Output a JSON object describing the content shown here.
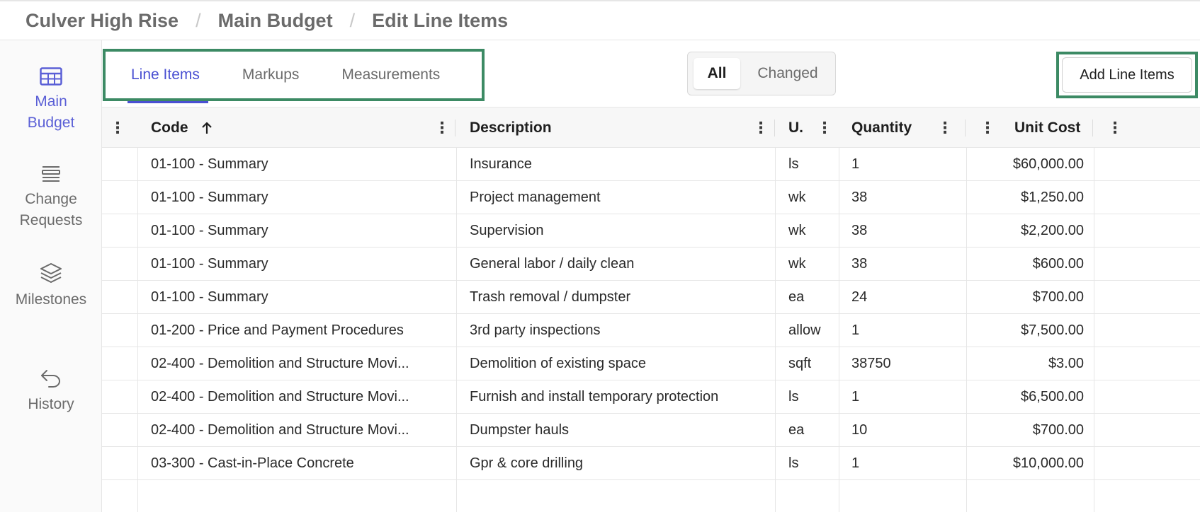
{
  "breadcrumb": [
    "Culver High Rise",
    "Main Budget",
    "Edit Line Items"
  ],
  "sidebar": {
    "items": [
      {
        "label_line1": "Main",
        "label_line2": "Budget",
        "icon": "table-icon",
        "active": true
      },
      {
        "label_line1": "Change",
        "label_line2": "Requests",
        "icon": "stack-lines-icon",
        "active": false
      },
      {
        "label_line1": "Milestones",
        "label_line2": "",
        "icon": "layers-icon",
        "active": false
      },
      {
        "label_line1": "History",
        "label_line2": "",
        "icon": "undo-arrow-icon",
        "active": false
      }
    ]
  },
  "tabs": [
    {
      "label": "Line Items",
      "active": true
    },
    {
      "label": "Markups",
      "active": false
    },
    {
      "label": "Measurements",
      "active": false
    }
  ],
  "filter": {
    "all_label": "All",
    "changed_label": "Changed",
    "selected": "All"
  },
  "actions": {
    "add_label": "Add Line Items"
  },
  "table": {
    "headers": {
      "code": "Code",
      "description": "Description",
      "unit": "U.",
      "quantity": "Quantity",
      "unit_cost": "Unit Cost"
    },
    "sort": {
      "column": "code",
      "direction": "ascending",
      "icon": "arrow-up-icon"
    },
    "rows": [
      {
        "code": "01-100 - Summary",
        "description": "Insurance",
        "unit": "ls",
        "quantity": "1",
        "unit_cost": "$60,000.00"
      },
      {
        "code": "01-100 - Summary",
        "description": "Project management",
        "unit": "wk",
        "quantity": "38",
        "unit_cost": "$1,250.00"
      },
      {
        "code": "01-100 - Summary",
        "description": "Supervision",
        "unit": "wk",
        "quantity": "38",
        "unit_cost": "$2,200.00"
      },
      {
        "code": "01-100 - Summary",
        "description": "General labor / daily clean",
        "unit": "wk",
        "quantity": "38",
        "unit_cost": "$600.00"
      },
      {
        "code": "01-100 - Summary",
        "description": "Trash removal / dumpster",
        "unit": "ea",
        "quantity": "24",
        "unit_cost": "$700.00"
      },
      {
        "code": "01-200 - Price and Payment Procedures",
        "description": "3rd party inspections",
        "unit": "allow",
        "quantity": "1",
        "unit_cost": "$7,500.00"
      },
      {
        "code": "02-400 - Demolition and Structure Movi...",
        "description": "Demolition of existing space",
        "unit": "sqft",
        "quantity": "38750",
        "unit_cost": "$3.00"
      },
      {
        "code": "02-400 - Demolition and Structure Movi...",
        "description": "Furnish and install temporary protection",
        "unit": "ls",
        "quantity": "1",
        "unit_cost": "$6,500.00"
      },
      {
        "code": "02-400 - Demolition and Structure Movi...",
        "description": "Dumpster hauls",
        "unit": "ea",
        "quantity": "10",
        "unit_cost": "$700.00"
      },
      {
        "code": "03-300 - Cast-in-Place Concrete",
        "description": "Gpr & core drilling",
        "unit": "ls",
        "quantity": "1",
        "unit_cost": "$10,000.00"
      }
    ]
  },
  "colors": {
    "accent": "#4a50d2",
    "highlight_border": "#3c8a64"
  }
}
